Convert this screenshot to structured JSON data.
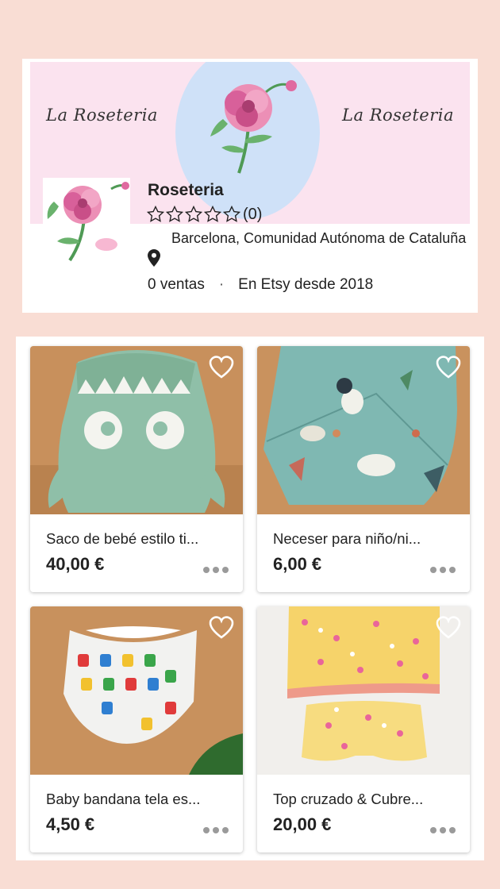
{
  "shop": {
    "banner_left": "La Roseteria",
    "banner_right": "La Roseteria",
    "name": "Roseteria",
    "rating_count": "(0)",
    "stars": 0,
    "location": "Barcelona, Comunidad Autónoma de Cataluña",
    "sales": "0 ventas",
    "separator": "·",
    "since": "En Etsy desde 2018"
  },
  "listings": [
    {
      "title": "Saco de bebé estilo ti...",
      "price": "40,00 €"
    },
    {
      "title": "Neceser para niño/ni...",
      "price": "6,00 €"
    },
    {
      "title": "Baby bandana tela es...",
      "price": "4,50 €"
    },
    {
      "title": "Top cruzado & Cubre...",
      "price": "20,00 €"
    }
  ],
  "colors": {
    "page_background": "#f9ddd4",
    "banner_pink": "#fbe3ef",
    "banner_blue": "#cfe1f8"
  }
}
